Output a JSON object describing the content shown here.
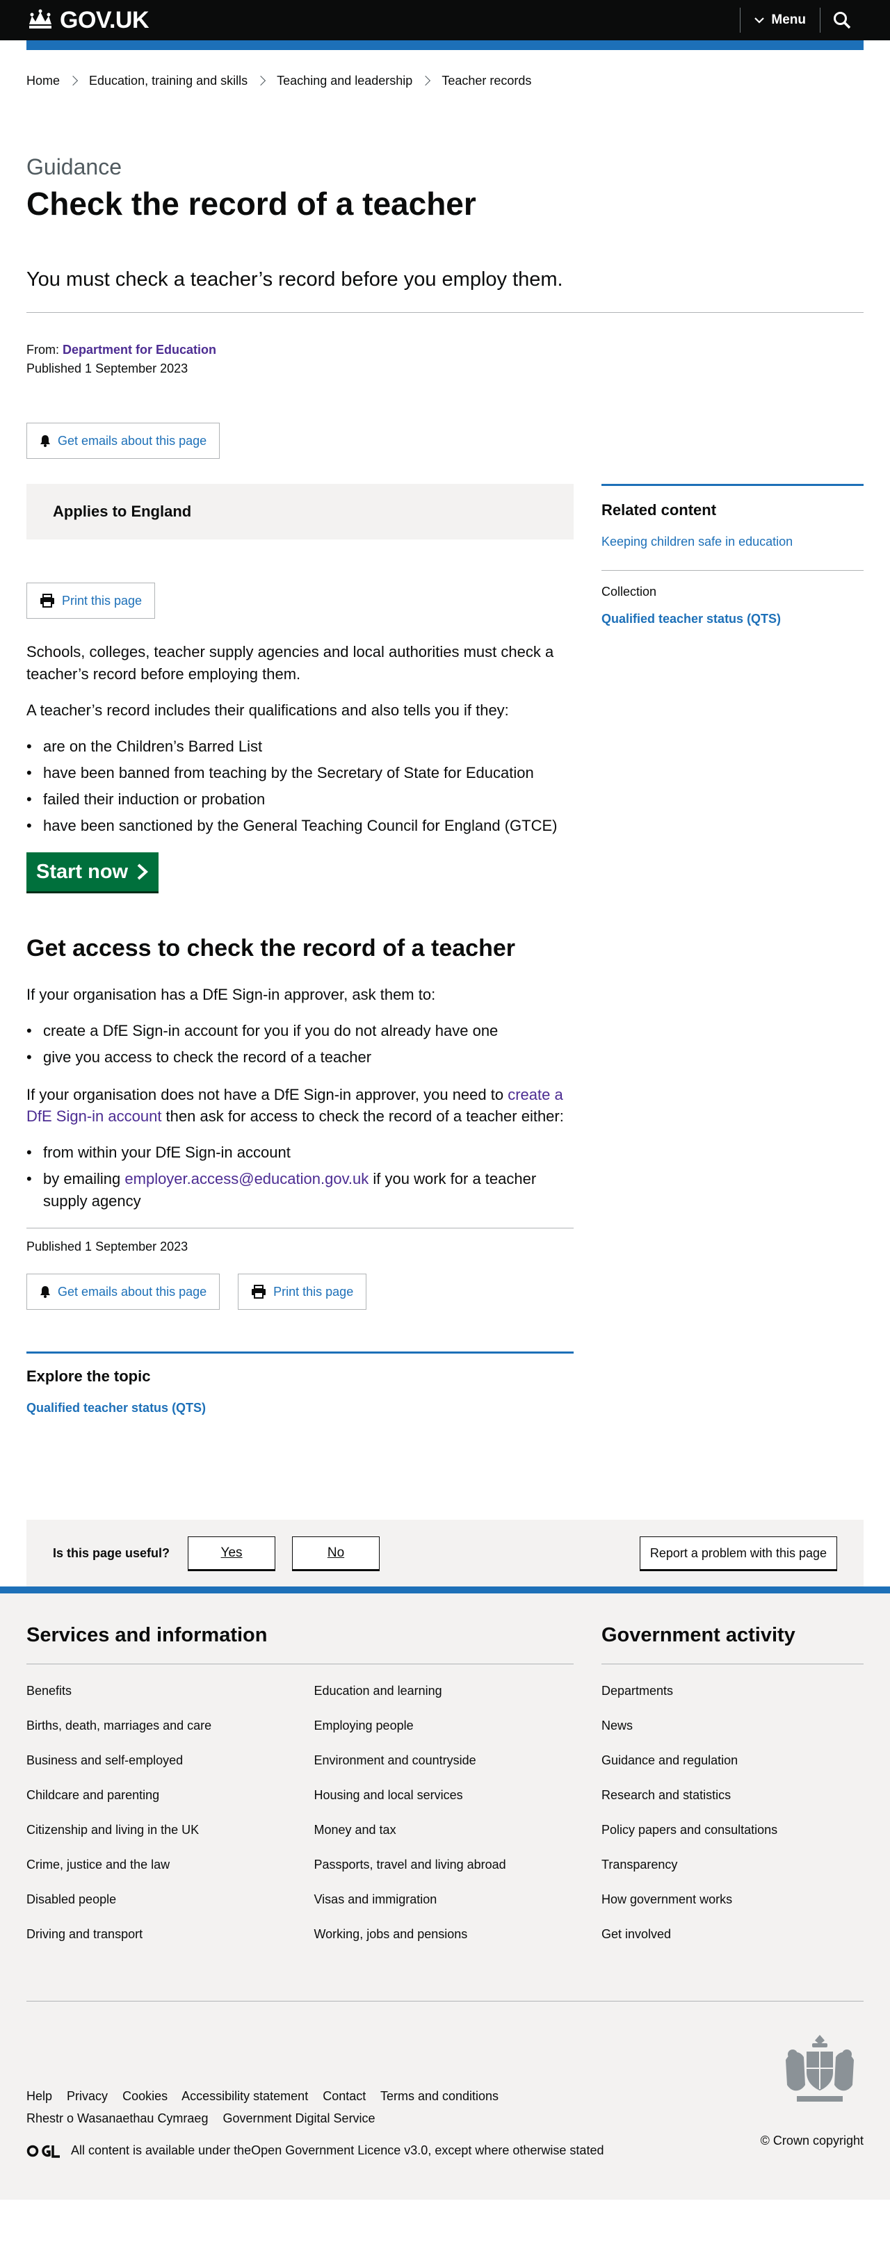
{
  "header": {
    "logo_text": "GOV.UK",
    "menu_label": "Menu"
  },
  "breadcrumbs": [
    "Home",
    "Education, training and skills",
    "Teaching and leadership",
    "Teacher records"
  ],
  "page": {
    "caption": "Guidance",
    "title": "Check the record of a teacher",
    "lead": "You must check a teacher’s record before you employ them.",
    "from_label": "From:",
    "from_org": "Department for Education",
    "published": "Published 1 September 2023",
    "get_emails": "Get emails about this page",
    "applies": "Applies to England",
    "print": "Print this page"
  },
  "body": {
    "p1": "Schools, colleges, teacher supply agencies and local authorities must check a teacher’s record before employing them.",
    "p2": "A teacher’s record includes their qualifications and also tells you if they:",
    "list1": [
      "are on the Children’s Barred List",
      "have been banned from teaching by the Secretary of State for Education",
      "failed their induction or probation",
      "have been sanctioned by the General Teaching Council for England (GTCE)"
    ],
    "start_now": "Start now",
    "h2": "Get access to check the record of a teacher",
    "p3": "If your organisation has a DfE Sign-in approver, ask them to:",
    "list2": [
      "create a DfE Sign-in account for you if you do not already have one",
      "give you access to check the record of a teacher"
    ],
    "p4_before": "If your organisation does not have a DfE Sign-in approver, you need to ",
    "p4_link": "create a DfE Sign-in account",
    "p4_after": " then ask for access to check the record of a teacher either:",
    "list3_item1": "from within your DfE Sign-in account",
    "list3_item2_before": "by emailing ",
    "list3_item2_link": "employer.access@education.gov.uk",
    "list3_item2_after": " if you work for a teacher supply agency"
  },
  "footer_meta": {
    "published": "Published 1 September 2023",
    "get_emails": "Get emails about this page",
    "print": "Print this page"
  },
  "explore": {
    "title": "Explore the topic",
    "link": "Qualified teacher status (QTS)"
  },
  "related": {
    "title": "Related content",
    "link": "Keeping children safe in education",
    "collection_label": "Collection",
    "collection_link": "Qualified teacher status (QTS)"
  },
  "feedback": {
    "question": "Is this page useful?",
    "yes": "Yes",
    "no": "No",
    "report": "Report a problem with this page"
  },
  "footer": {
    "services_title": "Services and information",
    "services": [
      "Benefits",
      "Education and learning",
      "Births, death, marriages and care",
      "Employing people",
      "Business and self-employed",
      "Environment and countryside",
      "Childcare and parenting",
      "Housing and local services",
      "Citizenship and living in the UK",
      "Money and tax",
      "Crime, justice and the law",
      "Passports, travel and living abroad",
      "Disabled people",
      "Visas and immigration",
      "Driving and transport",
      "Working, jobs and pensions"
    ],
    "gov_title": "Government activity",
    "gov": [
      "Departments",
      "News",
      "Guidance and regulation",
      "Research and statistics",
      "Policy papers and consultations",
      "Transparency",
      "How government works",
      "Get involved"
    ],
    "meta_links": [
      "Help",
      "Privacy",
      "Cookies",
      "Accessibility statement",
      "Contact",
      "Terms and conditions",
      "Rhestr o Wasanaethau Cymraeg",
      "Government Digital Service"
    ],
    "licence_before": "All content is available under the ",
    "licence_link": "Open Government Licence v3.0",
    "licence_after": ", except where otherwise stated",
    "copyright": "© Crown copyright"
  },
  "colors": {
    "header_black": "#0b0c0c",
    "brand_blue": "#1d70b8",
    "link_visited": "#4c2c92",
    "start_green": "#00703c",
    "panel_grey": "#f3f2f1"
  }
}
